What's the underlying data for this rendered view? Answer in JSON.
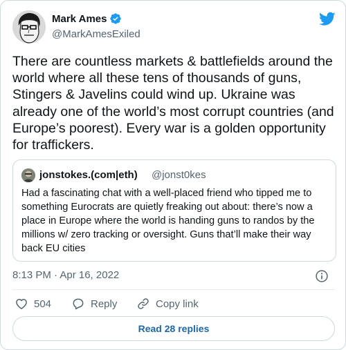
{
  "author": {
    "name": "Mark Ames",
    "handle": "@MarkAmesExiled",
    "verified": true
  },
  "tweet": {
    "text": "There are countless markets & battlefields around the world where all these tens of thousands of guns, Stingers & Javelins could wind up. Ukraine was already one of the world’s most corrupt countries (and Europe’s poorest). Every war is a golden opportunity for traffickers.",
    "timestamp": "8:13 PM · Apr 16, 2022"
  },
  "quoted": {
    "name": "jonstokes.(com|eth)",
    "handle": "@jonst0kes",
    "text": "Had a fascinating chat with a well-placed friend who tipped me to something  Eurocrats are quietly freaking out about: there’s now a place in Europe where the world is handing guns to randos by the millions w/ zero tracking or oversight. Guns that’ll make their way back EU cities"
  },
  "actions": {
    "like_count": "504",
    "reply_label": "Reply",
    "copy_link_label": "Copy link"
  },
  "replies_button": "Read 28 replies",
  "icons": {
    "brand": "twitter-bird-icon",
    "verified": "verified-badge-icon",
    "info": "info-icon",
    "like": "heart-icon",
    "reply": "reply-bubble-icon",
    "copy": "link-icon"
  },
  "colors": {
    "brand_blue": "#1d9bf0",
    "link_blue": "#1d67a6",
    "secondary_text": "#536471",
    "border": "#cfd9de"
  }
}
